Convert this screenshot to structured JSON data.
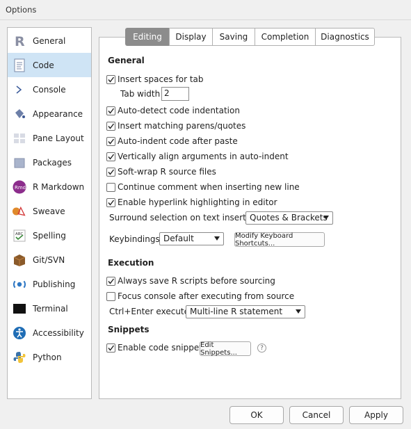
{
  "window": {
    "title": "Options"
  },
  "sidebar": {
    "items": [
      {
        "label": "General",
        "icon": "r-logo-icon"
      },
      {
        "label": "Code",
        "icon": "code-document-icon",
        "selected": true
      },
      {
        "label": "Console",
        "icon": "console-prompt-icon"
      },
      {
        "label": "Appearance",
        "icon": "paint-bucket-icon"
      },
      {
        "label": "Pane Layout",
        "icon": "pane-layout-icon"
      },
      {
        "label": "Packages",
        "icon": "packages-box-icon"
      },
      {
        "label": "R Markdown",
        "icon": "rmarkdown-icon"
      },
      {
        "label": "Sweave",
        "icon": "sweave-pdf-icon"
      },
      {
        "label": "Spelling",
        "icon": "spelling-check-icon"
      },
      {
        "label": "Git/SVN",
        "icon": "git-box-icon"
      },
      {
        "label": "Publishing",
        "icon": "publishing-icon"
      },
      {
        "label": "Terminal",
        "icon": "terminal-icon"
      },
      {
        "label": "Accessibility",
        "icon": "accessibility-icon"
      },
      {
        "label": "Python",
        "icon": "python-icon"
      }
    ]
  },
  "tabs": [
    {
      "label": "Editing",
      "active": true
    },
    {
      "label": "Display"
    },
    {
      "label": "Saving"
    },
    {
      "label": "Completion"
    },
    {
      "label": "Diagnostics"
    }
  ],
  "editing": {
    "general_heading": "General",
    "insert_spaces": {
      "label": "Insert spaces for tab",
      "checked": true
    },
    "tab_width": {
      "label": "Tab width",
      "value": "2"
    },
    "auto_detect": {
      "label": "Auto-detect code indentation",
      "checked": true
    },
    "matching_parens": {
      "label": "Insert matching parens/quotes",
      "checked": true
    },
    "auto_indent": {
      "label": "Auto-indent code after paste",
      "checked": true
    },
    "vertical_align": {
      "label": "Vertically align arguments in auto-indent",
      "checked": true
    },
    "soft_wrap": {
      "label": "Soft-wrap R source files",
      "checked": true
    },
    "continue_comment": {
      "label": "Continue comment when inserting new line",
      "checked": false
    },
    "hyperlink": {
      "label": "Enable hyperlink highlighting in editor",
      "checked": true
    },
    "surround": {
      "label": "Surround selection on text insertion:",
      "value": "Quotes & Brackets"
    },
    "keybindings": {
      "label": "Keybindings:",
      "value": "Default",
      "modify_button": "Modify Keyboard Shortcuts..."
    },
    "execution_heading": "Execution",
    "always_save": {
      "label": "Always save R scripts before sourcing",
      "checked": true
    },
    "focus_console": {
      "label": "Focus console after executing from source",
      "checked": false
    },
    "ctrl_enter": {
      "label": "Ctrl+Enter executes:",
      "value": "Multi-line R statement"
    },
    "snippets_heading": "Snippets",
    "enable_snippets": {
      "label": "Enable code snippets",
      "checked": true
    },
    "edit_snippets_button": "Edit Snippets...",
    "help": "?"
  },
  "footer": {
    "ok": "OK",
    "cancel": "Cancel",
    "apply": "Apply"
  }
}
